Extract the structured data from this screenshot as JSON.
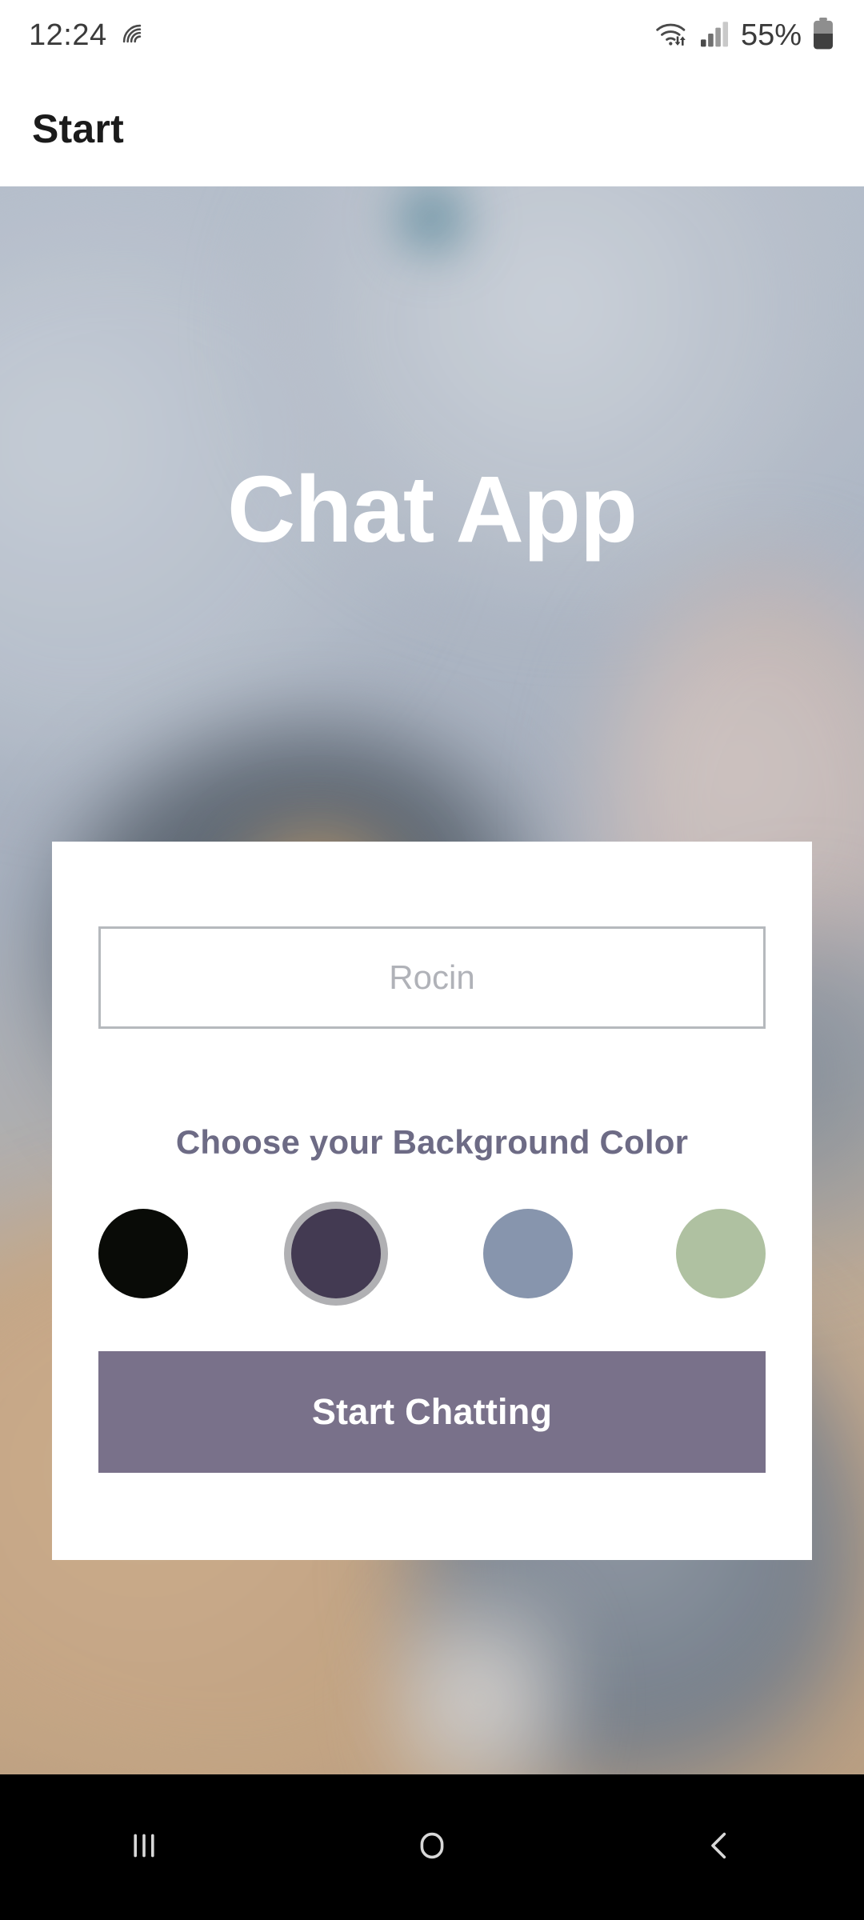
{
  "status_bar": {
    "time": "12:24",
    "battery_percent": "55%",
    "icons": [
      "nfc-icon",
      "wifi-icon",
      "cellular-signal-icon",
      "battery-icon"
    ]
  },
  "app_bar": {
    "title": "Start"
  },
  "hero": {
    "title": "Chat App"
  },
  "card": {
    "name_input": {
      "value": "",
      "placeholder": "Rocin"
    },
    "color_section": {
      "label": "Choose your Background Color",
      "swatches": [
        {
          "name": "black",
          "hex": "#090B07",
          "selected": false
        },
        {
          "name": "dark-purple",
          "hex": "#433A52",
          "selected": true
        },
        {
          "name": "slate-blue",
          "hex": "#8795AD",
          "selected": false
        },
        {
          "name": "sage-green",
          "hex": "#AFC1A1",
          "selected": false
        }
      ]
    },
    "start_button": {
      "label": "Start Chatting",
      "background": "#79718A",
      "text_color": "#FFFFFF"
    }
  },
  "nav_bar": {
    "recents_label": "recents-icon",
    "home_label": "home-icon",
    "back_label": "back-icon"
  }
}
